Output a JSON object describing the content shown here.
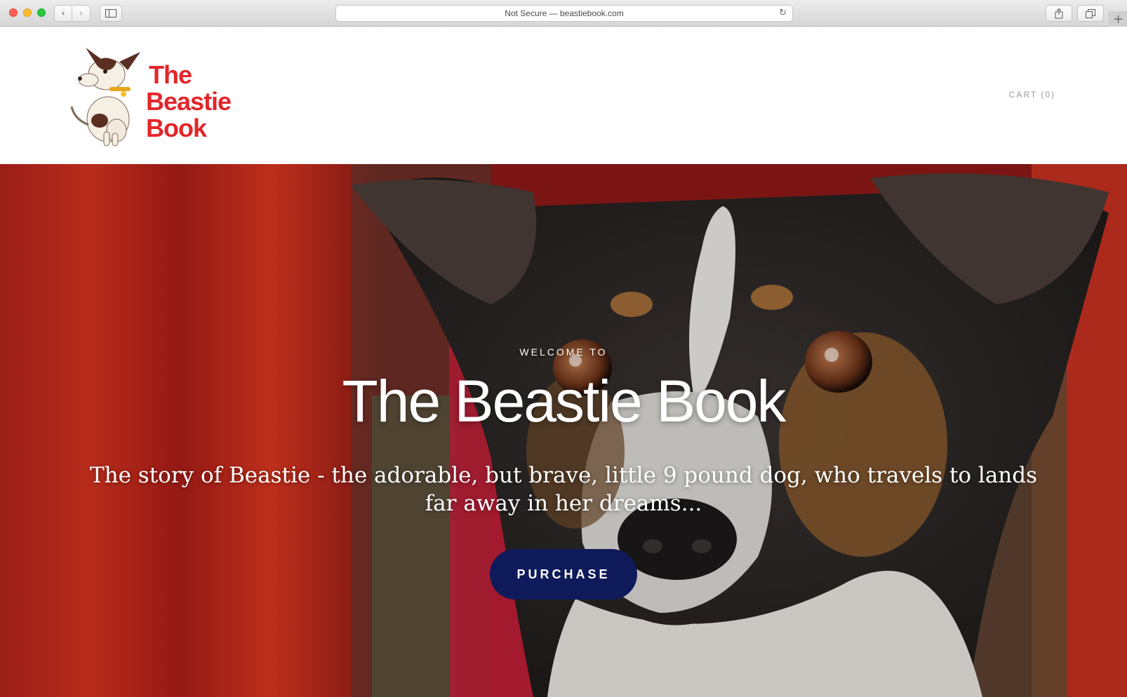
{
  "browser": {
    "address_text": "Not Secure — beastiebook.com",
    "back_icon": "chevron-left-icon",
    "forward_icon": "chevron-right-icon",
    "sidebar_icon": "sidebar-icon",
    "reload_icon": "reload-icon",
    "share_icon": "share-icon",
    "tabs_icon": "tabs-icon",
    "new_tab_icon": "plus-icon"
  },
  "header": {
    "logo_line1": "The",
    "logo_line2": "Beastie Book",
    "logo_color": "#e3262a",
    "cart_label": "CART (0)"
  },
  "hero": {
    "eyebrow": "WELCOME TO",
    "title": "The Beastie Book",
    "subtitle": "The story of Beastie - the adorable, but brave, little 9 pound dog, who travels to lands far away in her dreams...",
    "button_label": "PURCHASE",
    "button_color": "#0f1a5a"
  }
}
